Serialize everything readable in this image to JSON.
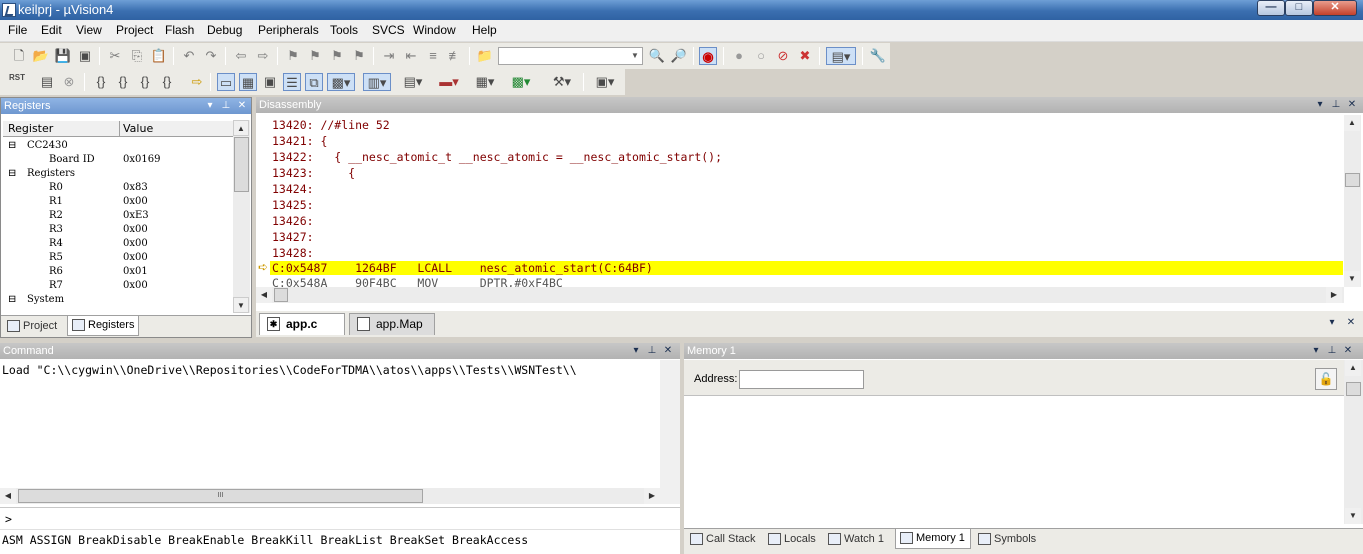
{
  "window": {
    "title": "keilprj  - µVision4",
    "minimize": "—",
    "maximize": "□",
    "close": "✕"
  },
  "menu": [
    "File",
    "Edit",
    "View",
    "Project",
    "Flash",
    "Debug",
    "Peripherals",
    "Tools",
    "SVCS",
    "Window",
    "Help"
  ],
  "toolbar": {
    "find_value": "",
    "rst_label": "RST"
  },
  "registers": {
    "title": "Registers",
    "col_register": "Register",
    "col_value": "Value",
    "rows": [
      {
        "name": "CC2430",
        "value": ""
      },
      {
        "name": "Board ID",
        "value": "0x0169"
      },
      {
        "name": "Registers",
        "value": ""
      },
      {
        "name": "R0",
        "value": "0x83"
      },
      {
        "name": "R1",
        "value": "0x00"
      },
      {
        "name": "R2",
        "value": "0xE3"
      },
      {
        "name": "R3",
        "value": "0x00"
      },
      {
        "name": "R4",
        "value": "0x00"
      },
      {
        "name": "R5",
        "value": "0x00"
      },
      {
        "name": "R6",
        "value": "0x01"
      },
      {
        "name": "R7",
        "value": "0x00"
      },
      {
        "name": "System",
        "value": ""
      }
    ],
    "tabs": [
      "Project",
      "Registers"
    ]
  },
  "disassembly": {
    "title": "Disassembly",
    "lines": [
      "13420: //#line 52",
      "13421: {",
      "13422:   { __nesc_atomic_t __nesc_atomic = __nesc_atomic_start();",
      "13423:     {",
      "13424:",
      "13425:",
      "13426:",
      "13427:",
      "13428:"
    ],
    "current_line": "C:0x5487    1264BF   LCALL    nesc_atomic_start(C:64BF)",
    "next_line": "C:0x548A    90F4BC   MOV      DPTR,#0xF4BC"
  },
  "editor_tabs": [
    "app.c",
    "app.Map"
  ],
  "command": {
    "title": "Command",
    "output": "Load \"C:\\\\cygwin\\\\OneDrive\\\\Repositories\\\\CodeForTDMA\\\\atos\\\\apps\\\\Tests\\\\WSNTest\\\\",
    "prompt": ">",
    "hint": "ASM ASSIGN BreakDisable BreakEnable BreakKill BreakList BreakSet BreakAccess",
    "scroll_grip": "III"
  },
  "memory": {
    "title": "Memory 1",
    "address_label": "Address:",
    "address_value": "",
    "tabs": [
      "Call Stack",
      "Locals",
      "Watch 1",
      "Memory 1",
      "Symbols"
    ]
  },
  "colors": {
    "panel_title": "#7aa2da",
    "current_line": "#ffff00",
    "code_text": "#800000"
  }
}
